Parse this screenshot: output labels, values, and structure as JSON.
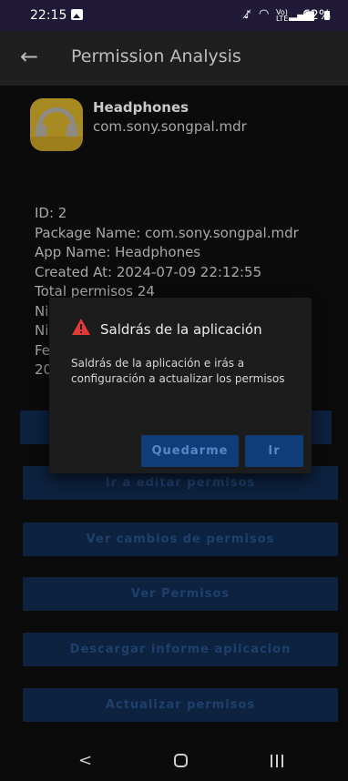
{
  "status_bar": {
    "time": "22:15",
    "lte_label": "Vo)\nLTE",
    "battery": "62%",
    "icons": [
      "gallery-icon",
      "mute-icon",
      "wifi-icon",
      "signal-icon",
      "battery-icon"
    ]
  },
  "app_bar": {
    "title": "Permission Analysis",
    "back_icon": "arrow-left-icon"
  },
  "app": {
    "name": "Headphones",
    "package": "com.sony.songpal.mdr"
  },
  "info": {
    "id": "ID: 2",
    "package_name": "Package Name: com.sony.songpal.mdr",
    "app_name": "App Name: Headphones",
    "created_at": "Created At: 2024-07-09 22:12:55",
    "total": "Total permisos 24",
    "line6": "Ni",
    "line7": "Ni",
    "line8": "Fe",
    "line9": "20"
  },
  "buttons": {
    "edit": "Ir a editar permisos",
    "changes": "Ver cambios de permisos",
    "view": "Ver Permisos",
    "download": "Descargar informe aplicacion",
    "update": "Actualizar permisos"
  },
  "dialog": {
    "title": "Saldrás de la aplicación",
    "body": "Saldrás de la aplicación e irás a configuración a actualizar los permisos",
    "stay_label": "Quedarme",
    "go_label": "Ir",
    "warning_color": "#e53935"
  },
  "colors": {
    "status_bar": "#201a38",
    "dialog_button": "#0f3d7a",
    "background": "#0b0b0b"
  }
}
